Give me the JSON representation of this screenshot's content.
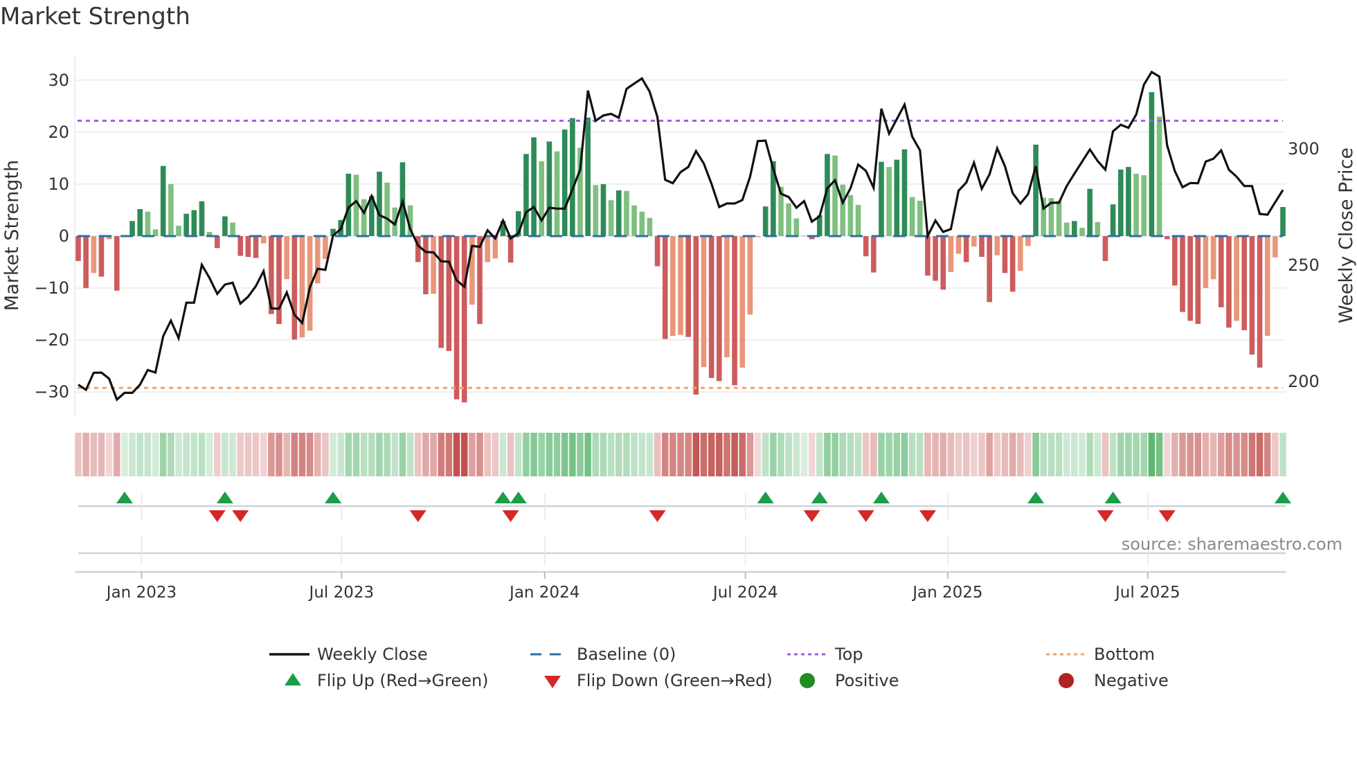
{
  "title": "Market Strength",
  "source": "source: sharemaestro.com",
  "colors": {
    "strong_green": "#2e8b57",
    "weak_green": "#7fbf7f",
    "strong_red": "#cd5c5c",
    "weak_red": "#e9967a",
    "line": "#111111",
    "baseline": "#2e6ea6",
    "top": "#9b5de5",
    "bottom": "#f4a261",
    "flip_up": "#1a9e48",
    "flip_down": "#d62728",
    "positive": "#228b22",
    "negative": "#b22222"
  },
  "legend": [
    {
      "label": "Weekly Close",
      "icon": "solid-line"
    },
    {
      "label": "Baseline (0)",
      "icon": "dashed-line"
    },
    {
      "label": "Top",
      "icon": "dotted-purple-line"
    },
    {
      "label": "Bottom",
      "icon": "dotted-orange-line"
    },
    {
      "label": "Flip Up (Red→Green)",
      "icon": "triangle-up"
    },
    {
      "label": "Flip Down (Green→Red)",
      "icon": "triangle-down"
    },
    {
      "label": "Positive",
      "icon": "green-circle"
    },
    {
      "label": "Negative",
      "icon": "red-circle"
    }
  ],
  "chart_data": {
    "type": "bar",
    "title": "Market Strength",
    "ylabel": "Market Strength",
    "y2label": "Weekly Close Price",
    "ylim": [
      -34.5,
      34.5
    ],
    "y2lim": [
      185.5,
      339.5
    ],
    "yticks": [
      -30,
      -20,
      -10,
      0,
      10,
      20,
      30
    ],
    "ytick_labels": [
      "−30",
      "−20",
      "−10",
      "0",
      "10",
      "20",
      "30"
    ],
    "y2ticks": [
      200,
      250,
      300
    ],
    "y2tick_labels": [
      "200",
      "250",
      "300"
    ],
    "top_level": 22.2,
    "bottom_level": -29.2,
    "baseline": 0,
    "x_unit": "week index",
    "xticks": [
      {
        "label": "Jan 2023",
        "week": 8.2
      },
      {
        "label": "Jul 2023",
        "week": 34.1
      },
      {
        "label": "Jan 2024",
        "week": 60.4
      },
      {
        "label": "Jul 2024",
        "week": 86.4
      },
      {
        "label": "Jan 2025",
        "week": 112.6
      },
      {
        "label": "Jul 2025",
        "week": 138.5
      }
    ],
    "strength": [
      -4.8,
      -10,
      -7.1,
      -7.8,
      -0.6,
      -10.5,
      0.1,
      2.9,
      5.2,
      4.7,
      1.3,
      13.5,
      10,
      2,
      4.3,
      5,
      6.7,
      0.8,
      -2.3,
      3.8,
      2.6,
      -3.8,
      -4,
      -4.2,
      -1.4,
      -15,
      -16.9,
      -8.3,
      -19.9,
      -19.5,
      -18.2,
      -9.1,
      -4.4,
      1.4,
      3.1,
      12,
      11.8,
      7.1,
      7.7,
      12.4,
      10.3,
      5.5,
      14.2,
      5.9,
      -5,
      -11.2,
      -11.1,
      -21.5,
      -22.1,
      -31.4,
      -32,
      -13.2,
      -16.9,
      -5,
      -4.3,
      2.9,
      -5.1,
      4.8,
      15.8,
      19,
      14.4,
      18.2,
      16.3,
      20.5,
      22.7,
      17,
      22.8,
      9.8,
      10,
      6.9,
      8.8,
      8.7,
      5.9,
      4.7,
      3.5,
      -5.8,
      -19.8,
      -19.2,
      -19,
      -19.4,
      -30.5,
      -25.2,
      -27.3,
      -27.9,
      -23.3,
      -28.7,
      -25.3,
      -15.1,
      -0.2,
      5.7,
      14.4,
      9.5,
      6.3,
      3.4,
      0.1,
      -0.6,
      4,
      15.8,
      15.5,
      9.9,
      7.9,
      6,
      -3.9,
      -7,
      14.3,
      13.3,
      14.7,
      16.7,
      7.5,
      6.8,
      -7.6,
      -8.6,
      -10.3,
      -6.9,
      -3.4,
      -5,
      -2,
      -4,
      -12.7,
      -3.7,
      -7.1,
      -10.7,
      -6.7,
      -1.9,
      17.6,
      7.4,
      7.3,
      6.8,
      2.6,
      2.9,
      1.6,
      9.1,
      2.7,
      -4.8,
      6.1,
      12.8,
      13.3,
      12,
      11.7,
      27.7,
      23,
      -0.6,
      -9.5,
      -14.6,
      -16.3,
      -16.9,
      -10,
      -8.3,
      -13.7,
      -17.6,
      -16.3,
      -18.1,
      -22.8,
      -25.3,
      -19.2,
      -4.1,
      5.6
    ],
    "weekly_close": [
      198.7,
      196.5,
      203.8,
      203.9,
      201.3,
      192.3,
      195.2,
      195.2,
      198.7,
      205,
      203.9,
      219.5,
      226.2,
      218.7,
      233.9,
      233.9,
      250.2,
      244.5,
      237.7,
      241.7,
      242.5,
      233.5,
      236.5,
      241,
      247.5,
      231.5,
      231.3,
      238.3,
      228.7,
      225.2,
      240.5,
      248.5,
      248,
      262.7,
      265.5,
      274.8,
      277.5,
      272.5,
      279.7,
      271.5,
      270,
      267.5,
      277.3,
      265.5,
      258.5,
      255.7,
      255.5,
      251.7,
      251.5,
      243.5,
      240.7,
      258.3,
      257.9,
      265,
      261.5,
      269.2,
      261.5,
      263.7,
      272.8,
      275,
      269.2,
      274.7,
      274.3,
      274.3,
      282.5,
      291,
      325,
      312,
      314.3,
      315,
      313.3,
      325.7,
      328,
      330.2,
      324.5,
      313.7,
      286.7,
      285.2,
      290,
      292.2,
      299,
      293.7,
      285,
      275,
      276.5,
      276.5,
      278,
      288,
      303.3,
      303.5,
      291.5,
      280.7,
      279.3,
      274.7,
      277.5,
      268.7,
      271,
      283,
      286.5,
      276.8,
      283,
      293.2,
      290.5,
      283.2,
      317.2,
      306.5,
      312.7,
      319,
      305.2,
      299.3,
      262.5,
      269.2,
      264.3,
      265.5,
      282,
      285.5,
      294,
      282.8,
      289,
      300.2,
      292.5,
      281,
      276.5,
      280.5,
      292.5,
      274.3,
      276.8,
      276.8,
      284,
      289.3,
      294.5,
      299.7,
      294.8,
      291,
      307.5,
      310.3,
      309,
      314.7,
      327.5,
      333,
      331,
      301.5,
      290.5,
      283.5,
      285.3,
      285.2,
      294.5,
      295.7,
      299.3,
      291,
      288,
      284,
      284,
      272,
      271.7,
      277,
      282.3
    ]
  }
}
